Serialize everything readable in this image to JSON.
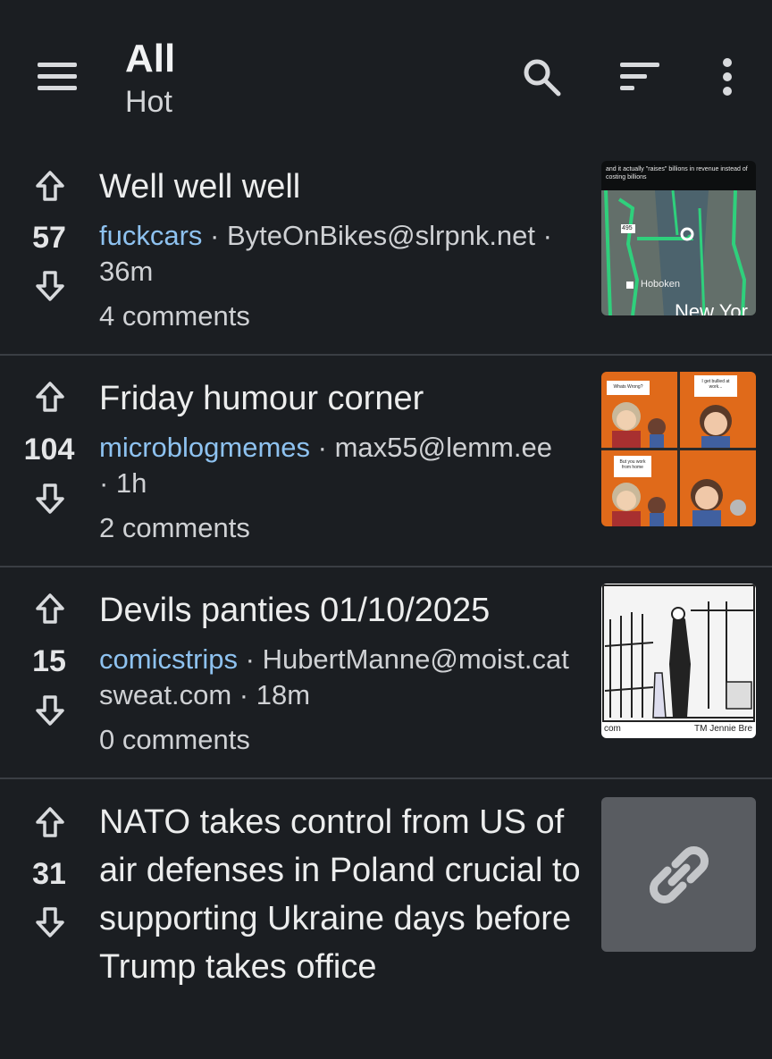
{
  "header": {
    "title": "All",
    "subtitle": "Hot"
  },
  "posts": [
    {
      "score": "57",
      "title": "Well well well",
      "community": "fuckcars",
      "author_line": " · ByteOnBikes@slrpnk.net · 36m",
      "comments": "4 comments",
      "thumb_text": "and it actually \"raises\" billions in revenue instead of costing billions",
      "thumb_labels": [
        "495",
        "Hoboken",
        "New Yor"
      ]
    },
    {
      "score": "104",
      "title": "Friday humour corner",
      "community": "microblogmemes",
      "author_line": " · max55@lemm.ee · 1h",
      "comments": "2 comments",
      "thumb_bubbles": [
        "Whats Wrong?",
        "I get bullied at work...",
        "But you work from home"
      ]
    },
    {
      "score": "15",
      "title": "Devils panties 01/10/2025",
      "community": "comicstrips",
      "author_line": " · HubertManne@moist.catsweat.com · 18m",
      "comments": "0 comments",
      "thumb_caption_left": "com",
      "thumb_caption_right": "TM Jennie Bre"
    },
    {
      "score": "31",
      "title": "NATO takes control from US of air defenses in Poland crucial to supporting Ukraine days before Trump takes office",
      "thumb_icon": "link-icon"
    }
  ],
  "colors": {
    "background": "#1b1e22",
    "community_link": "#8ec2f0",
    "divider": "#3a3e44"
  }
}
